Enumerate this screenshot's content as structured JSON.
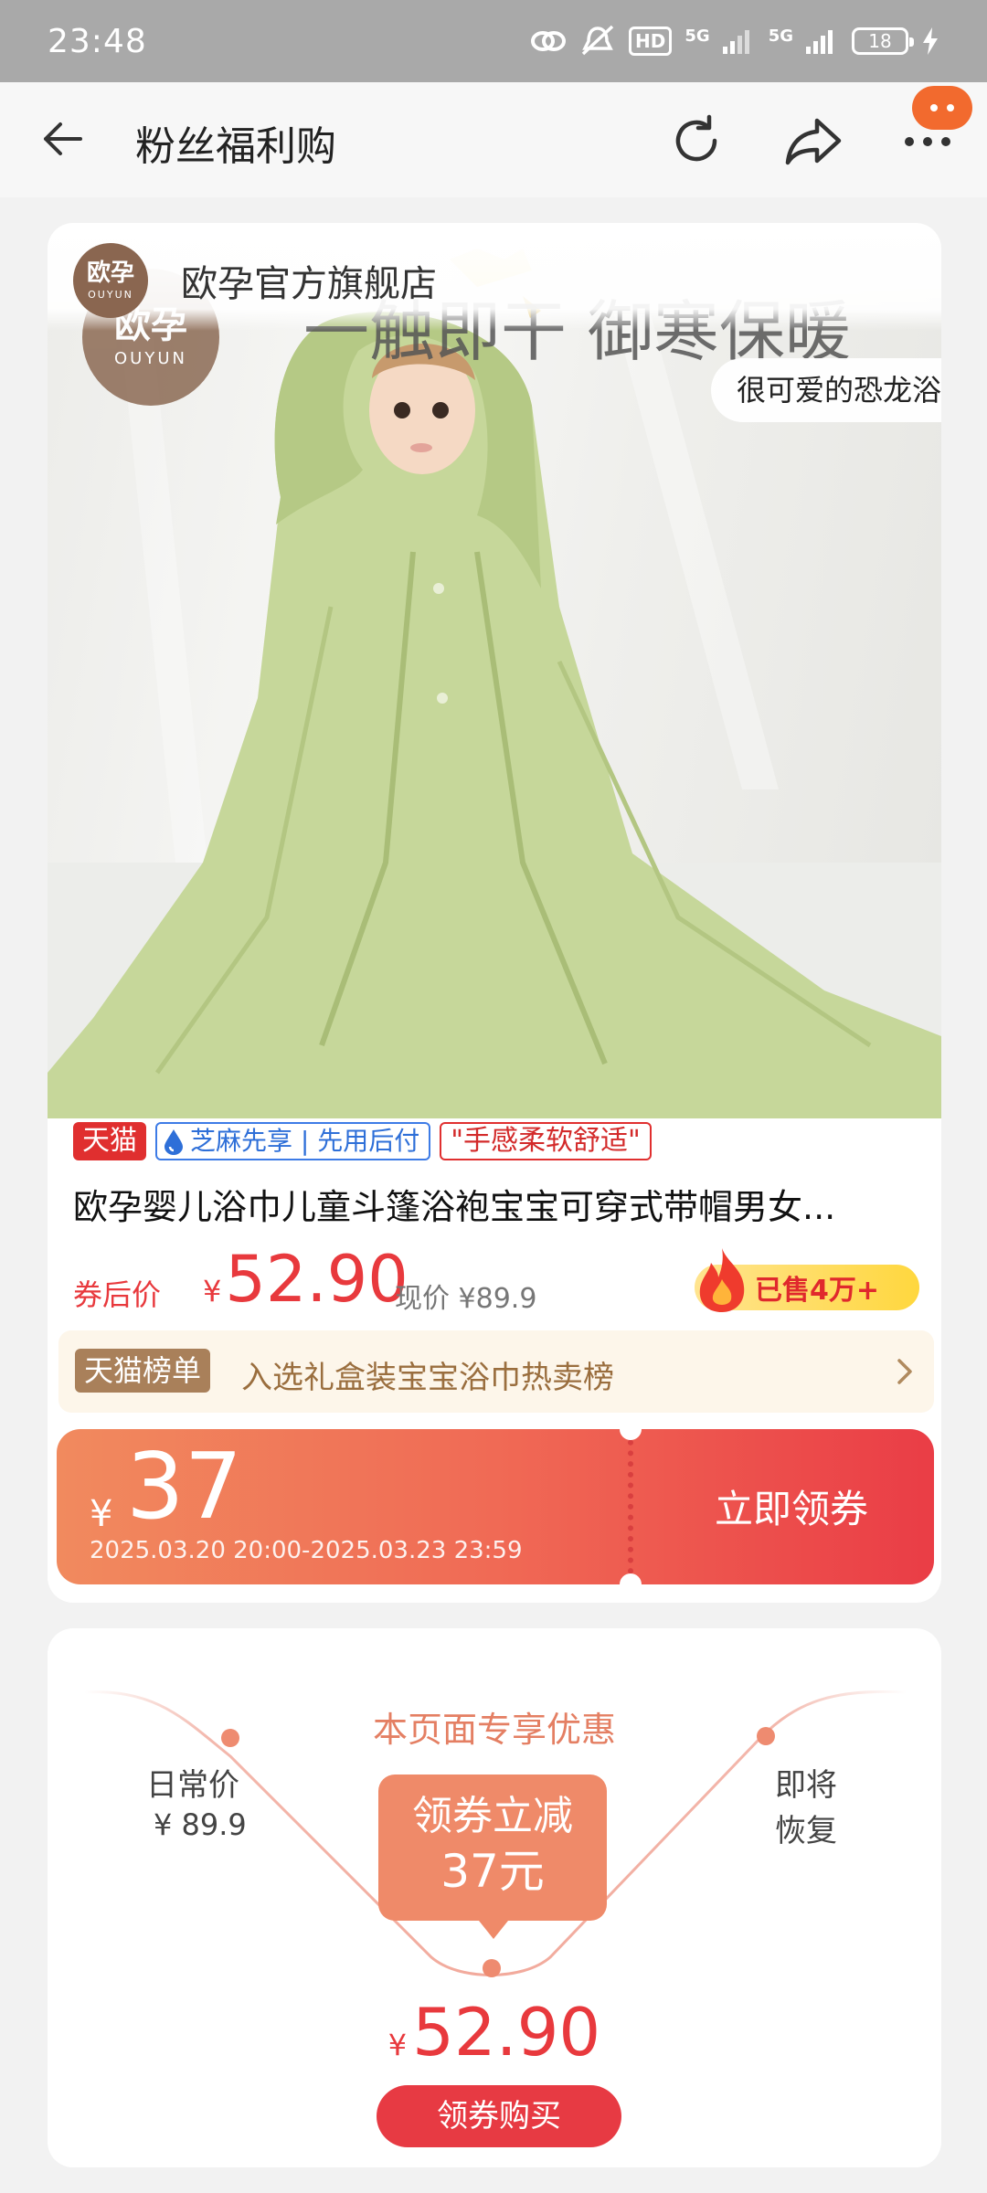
{
  "status_bar": {
    "time": "23:48",
    "hd_label": "HD",
    "net1_label": "5G",
    "net2_label": "5G",
    "battery_level": "18"
  },
  "nav": {
    "title": "粉丝福利购"
  },
  "store": {
    "logo_cn": "欧孕",
    "logo_en": "OUYUN",
    "name": "欧孕官方旗舰店"
  },
  "product_image": {
    "headline": "一触即干  御寒保暖",
    "tag": "很可爱的恐龙浴"
  },
  "badges": {
    "tmall": "天猫",
    "zhima": "芝麻先享 | 先用后付",
    "feel": "\"手感柔软舒适\""
  },
  "product": {
    "title": "欧孕婴儿浴巾儿童斗篷浴袍宝宝可穿式带帽男女...",
    "price_label": "券后价",
    "yen": "¥",
    "price": "52.90",
    "current_price": "现价 ¥89.9",
    "sold": "已售4万+"
  },
  "ranking": {
    "tag": "天猫榜单",
    "text": "入选礼盒装宝宝浴巾热卖榜"
  },
  "coupon": {
    "yen": "¥",
    "amount": "37",
    "period": "2025.03.20 20:00-2025.03.23 23:59",
    "claim_label": "立即领券"
  },
  "promo": {
    "title": "本页面专享优惠",
    "daily_label": "日常价",
    "daily_price": "¥ 89.9",
    "restore_line1": "即将",
    "restore_line2": "恢复",
    "discount_line1": "领券立减",
    "discount_line2": "37元",
    "final_yen": "¥",
    "final_price": "52.90",
    "buy_label": "领券购买"
  },
  "colors": {
    "accent_red": "#e8393d",
    "coupon_start": "#f18a5e",
    "coupon_end": "#ea3d46",
    "towel_green": "#c6d79a",
    "rank_brown": "#a9805a"
  }
}
